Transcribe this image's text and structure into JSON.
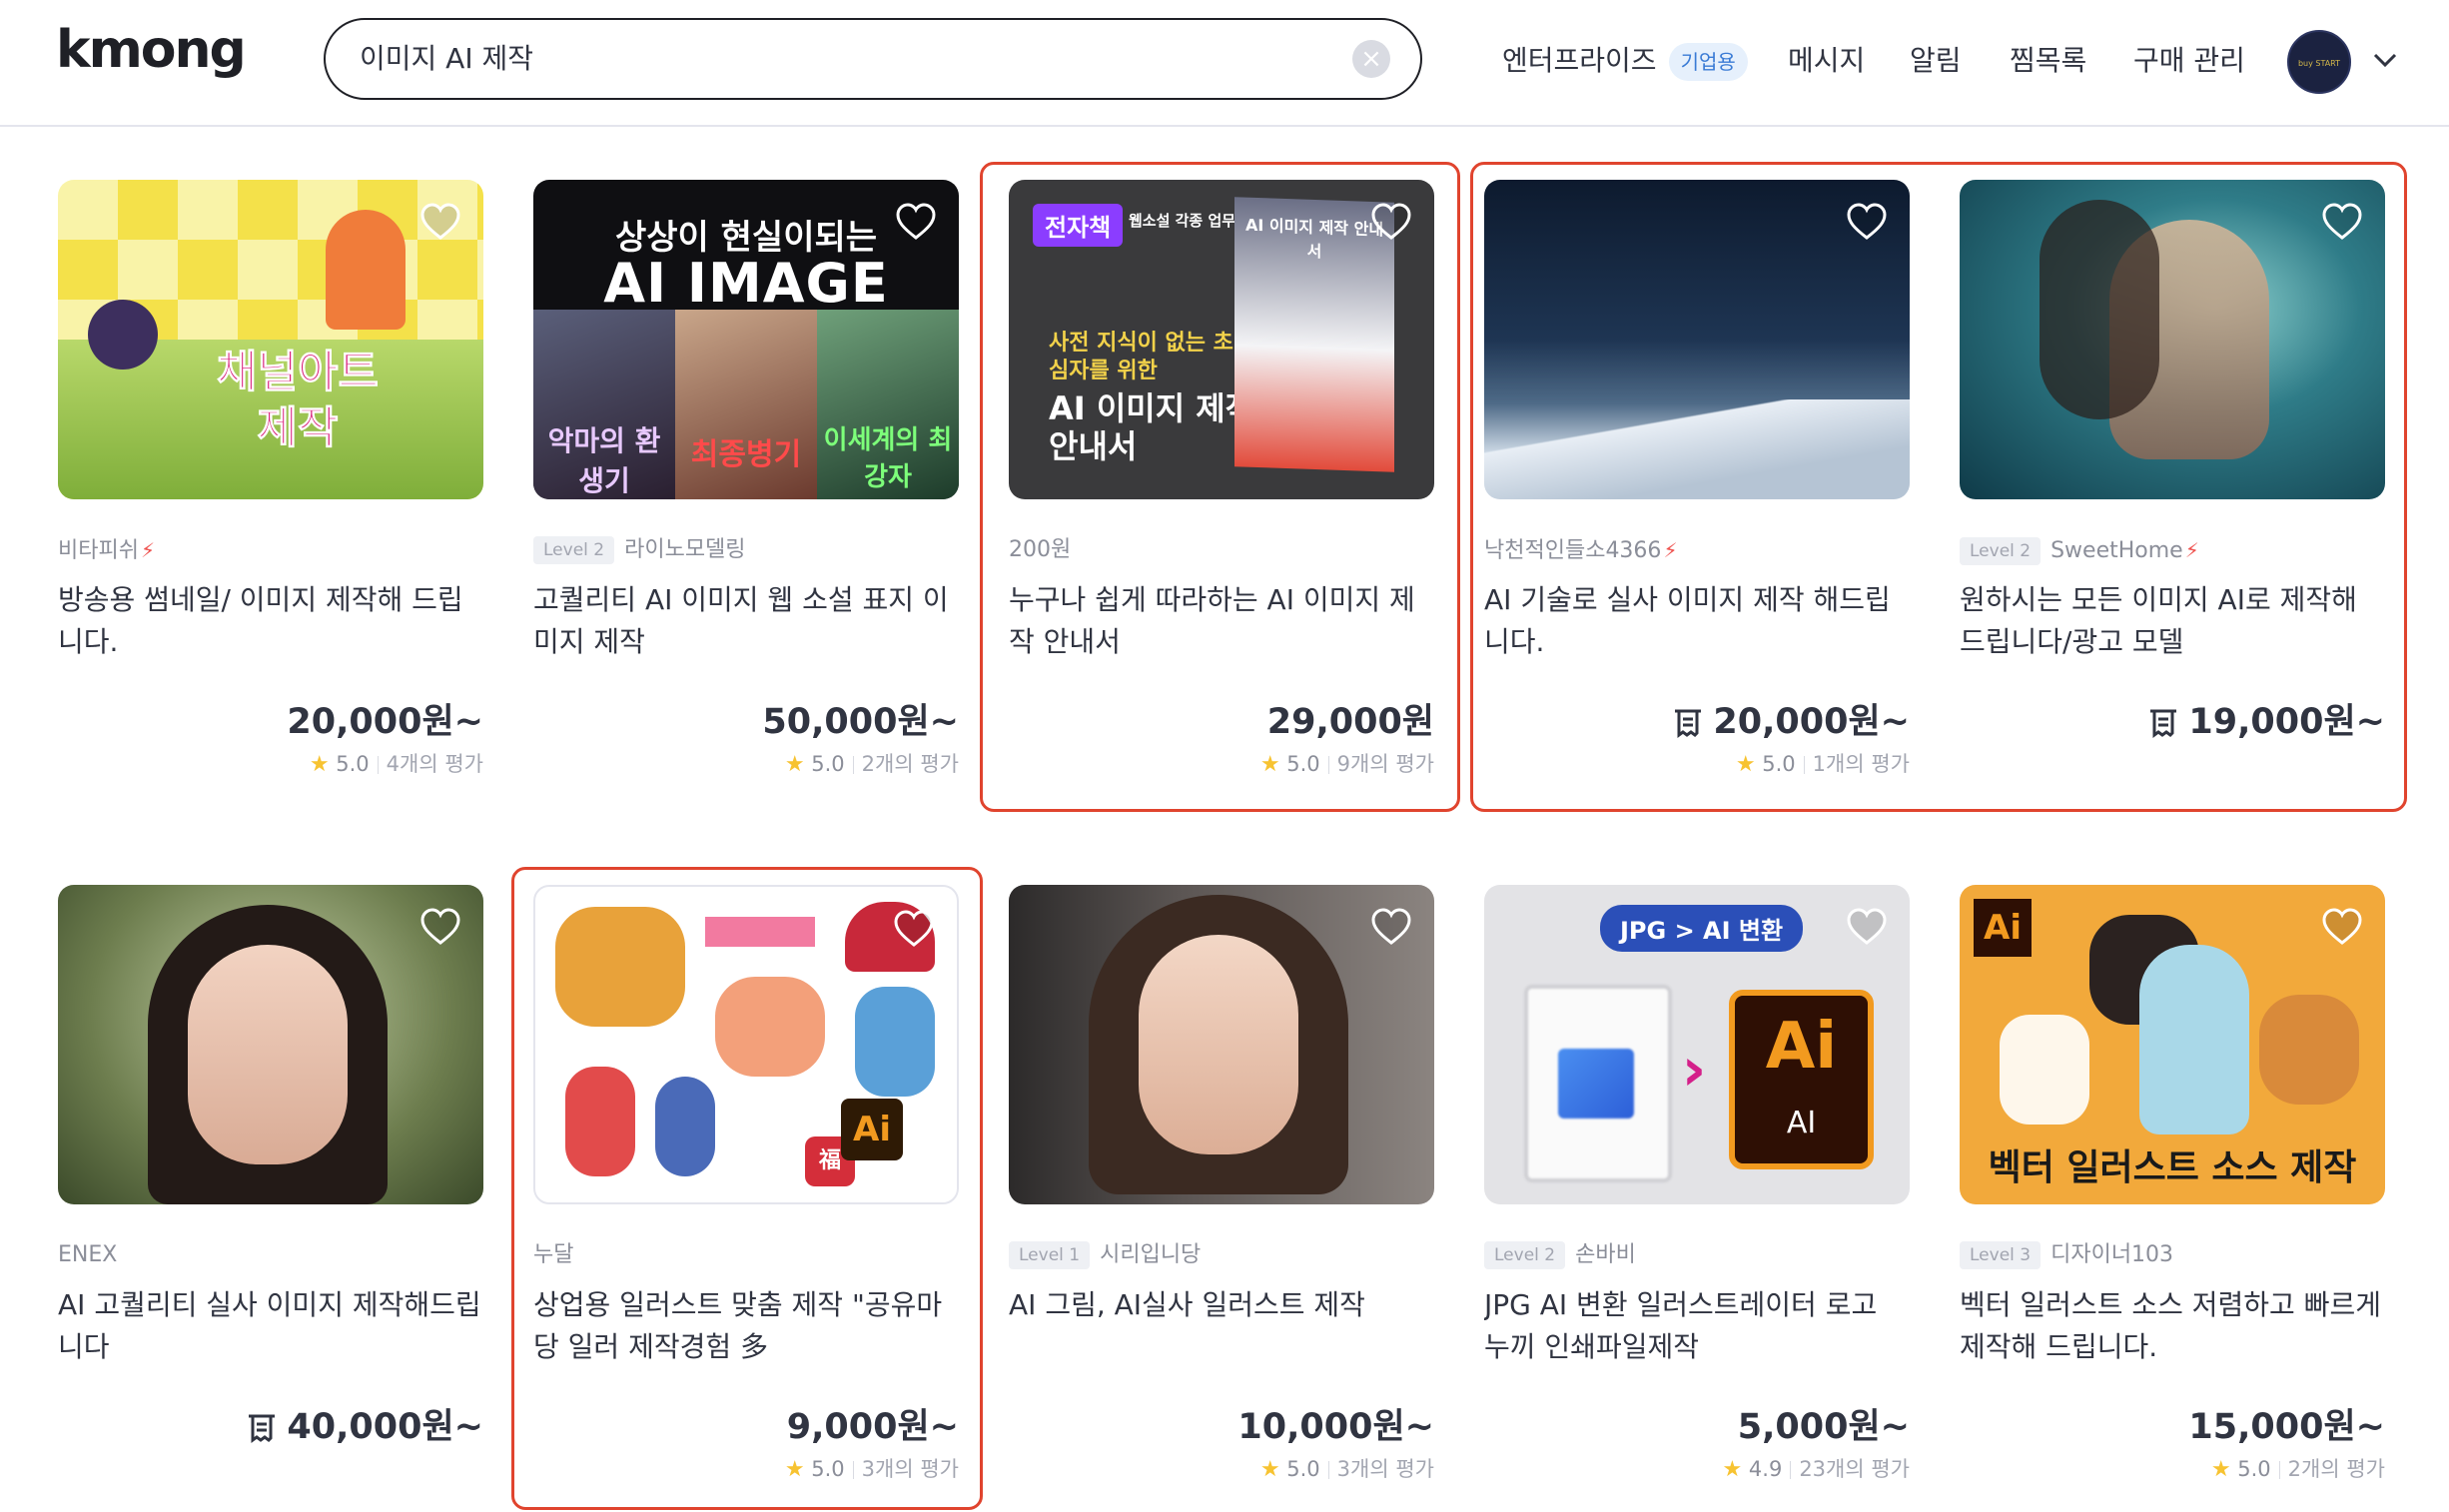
{
  "header": {
    "logo": "kmong",
    "search_value": "이미지 AI 제작",
    "nav": {
      "enterprise": "엔터프라이즈",
      "enterprise_badge": "기업용",
      "messages": "메시지",
      "alerts": "알림",
      "wishlist": "찜목록",
      "purchases": "구매 관리"
    },
    "avatar_text": "buy START"
  },
  "cards": [
    {
      "seller": "비타피쉬",
      "level": "",
      "title": "방송용 썸네일/ 이미지 제작해 드립니다.",
      "price": "20,000원~",
      "rating": "5.0",
      "reviews": "4개의 평가",
      "thumb_text": [
        "채널아트",
        "제작"
      ]
    },
    {
      "seller": "라이노모델링",
      "level": "Level 2",
      "title": "고퀄리티 AI 이미지 웹 소설 표지 이미지 제작",
      "price": "50,000원~",
      "rating": "5.0",
      "reviews": "2개의 평가",
      "thumb_text": [
        "상상이 현실이되는",
        "AI IMAGE",
        "악마의 환생기",
        "최종병기",
        "이세계의 최강자"
      ]
    },
    {
      "seller": "200원",
      "level": "",
      "title": "누구나 쉽게 따라하는 AI 이미지 제작 안내서",
      "price": "29,000원",
      "rating": "5.0",
      "reviews": "9개의 평가",
      "thumb_text": [
        "전자책",
        "웹소설 각종 업무",
        "사전 지식이 없는 초심자를 위한",
        "AI 이미지 제작 안내서",
        "AI 이미지 제작 안내서"
      ]
    },
    {
      "seller": "낙천적인들소4366",
      "level": "",
      "title": "AI 기술로 실사 이미지 제작 해드립니다.",
      "price": "20,000원~",
      "rating": "5.0",
      "reviews": "1개의 평가"
    },
    {
      "seller": "SweetHome",
      "level": "Level 2",
      "title": "원하시는 모든 이미지 AI로 제작해 드립니다/광고 모델",
      "price": "19,000원~",
      "rating": "",
      "reviews": ""
    },
    {
      "seller": "ENEX",
      "level": "",
      "title": "AI 고퀄리티 실사 이미지 제작해드립니다",
      "price": "40,000원~",
      "rating": "",
      "reviews": ""
    },
    {
      "seller": "누달",
      "level": "",
      "title": "상업용 일러스트 맞춤 제작 \"공유마당 일러 제작경험 多",
      "price": "9,000원~",
      "rating": "5.0",
      "reviews": "3개의 평가",
      "thumb_text": [
        "Ai",
        "福"
      ]
    },
    {
      "seller": "시리입니당",
      "level": "Level 1",
      "title": "AI 그림, AI실사 일러스트 제작",
      "price": "10,000원~",
      "rating": "5.0",
      "reviews": "3개의 평가"
    },
    {
      "seller": "손바비",
      "level": "Level 2",
      "title": "JPG AI 변환 일러스트레이터 로고 누끼 인쇄파일제작",
      "price": "5,000원~",
      "rating": "4.9",
      "reviews": "23개의 평가",
      "thumb_text": [
        "JPG > AI 변환",
        "Ai",
        "AI"
      ]
    },
    {
      "seller": "디자이너103",
      "level": "Level 3",
      "title": "벡터 일러스트 소스 저렴하고 빠르게 제작해 드립니다.",
      "price": "15,000원~",
      "rating": "5.0",
      "reviews": "2개의 평가",
      "thumb_text": [
        "Ai",
        "벡터 일러스트 소스 제작"
      ]
    }
  ],
  "colors": {
    "highlight": "#e0442e",
    "bolt": "#ef5350",
    "star": "#f7c331",
    "badge_bg": "#e6f0fc"
  },
  "icons": [
    "search-clear-icon",
    "heart-icon",
    "star-icon",
    "lightning-icon",
    "chevron-down-icon",
    "receipt-icon"
  ]
}
